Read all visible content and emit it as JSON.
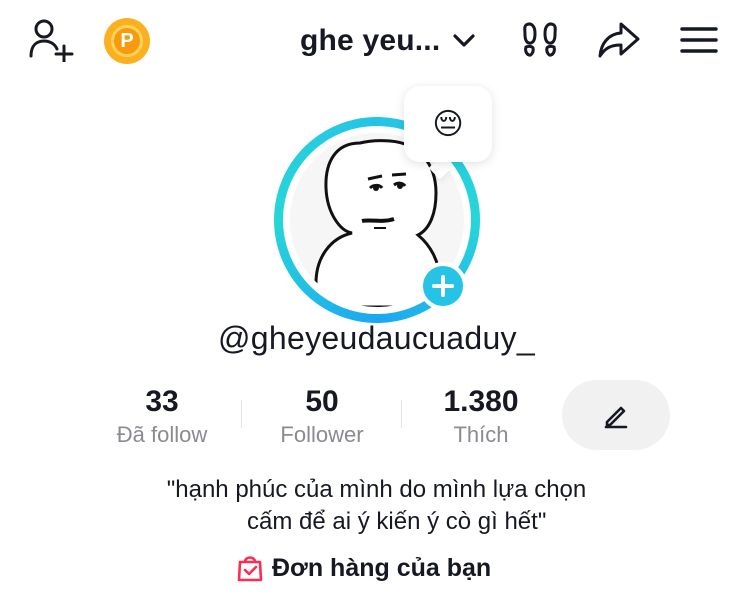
{
  "header": {
    "title": "ghe yeu...",
    "coin_letter": "P",
    "icons": {
      "add_friend": "person-add-icon",
      "coin": "coin-icon",
      "dropdown": "chevron-down-icon",
      "footprint": "footprint-icon",
      "share": "share-arrow-icon",
      "menu": "hamburger-menu-icon"
    }
  },
  "profile": {
    "mood_emoji": "😔",
    "username": "@gheyeudaucuaduy_",
    "avatar": "cartoon-avatar-image"
  },
  "stats": [
    {
      "value": "33",
      "label": "Đã follow"
    },
    {
      "value": "50",
      "label": "Follower"
    },
    {
      "value": "1.380",
      "label": "Thích"
    }
  ],
  "bio": {
    "line1": "\"hạnh phúc của mình do mình lựa chọn",
    "line2": "cấm để ai ý kiến ý cò gì hết\""
  },
  "orders": {
    "label": "Đơn hàng của bạn",
    "icon": "shopping-bag-check-icon"
  },
  "colors": {
    "accent": "#25c4e6",
    "coin": "#fbb11f",
    "orders_icon": "#fe2c55"
  }
}
